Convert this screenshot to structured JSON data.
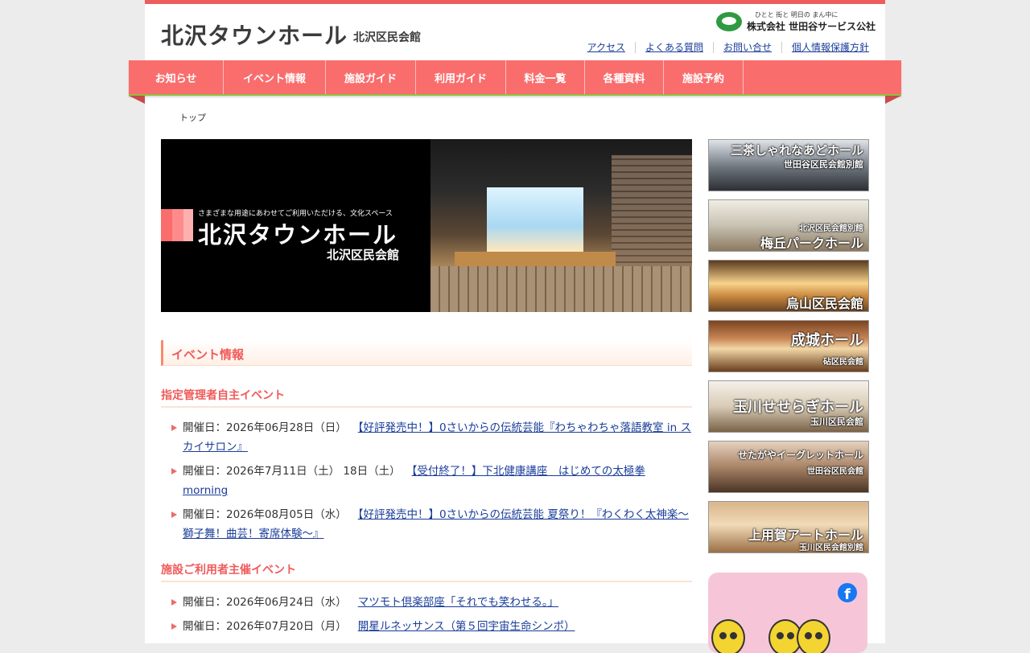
{
  "header": {
    "site_title": "北沢タウンホール",
    "site_subtitle": "北沢区民会館",
    "corp_tagline": "ひとと 街と 明日の まん中に",
    "corp_name": "株式会社 世田谷サービス公社",
    "top_links": [
      "アクセス",
      "よくある質問",
      "お問い合せ",
      "個人情報保護方針"
    ]
  },
  "nav": [
    "お知らせ",
    "イベント情報",
    "施設ガイド",
    "利用ガイド",
    "料金一覧",
    "各種資料",
    "施設予約"
  ],
  "breadcrumb": "トップ",
  "hero": {
    "tagline": "さまざまな用途にあわせてご利用いただける、文化スペース",
    "title": "北沢タウンホール",
    "subtitle": "北沢区民会館"
  },
  "events": {
    "heading": "イベント情報",
    "managed_heading": "指定管理者自主イベント",
    "managed": [
      {
        "date": "開催日：2026年06月28日（日）",
        "title": "【好評発売中！】0さいからの伝統芸能『わちゃわちゃ落語教室 in スカイサロン』"
      },
      {
        "date": "開催日：2026年7月11日（土） 18日（土）",
        "title": "【受付終了！】下北健康講座　はじめての太極拳 morning"
      },
      {
        "date": "開催日：2026年08月05日（水）",
        "title": "【好評発売中！】0さいからの伝統芸能 夏祭り！『わくわく太神楽～獅子舞！曲芸！寄席体験～』"
      }
    ],
    "user_heading": "施設ご利用者主催イベント",
    "user": [
      {
        "date": "開催日：2026年06月24日（水）",
        "title": "マツモト倶楽部座「それでも笑わせる。」"
      },
      {
        "date": "開催日：2026年07月20日（月）",
        "title": "開星ルネッサンス（第５回宇宙生命シンポ）"
      }
    ]
  },
  "banners": [
    {
      "main": "三茶しゃれなあどホール",
      "sub": "世田谷区民会館別館"
    },
    {
      "main": "梅丘パークホール",
      "sub": "北沢区民会館別館"
    },
    {
      "main": "烏山区民会館",
      "sub": ""
    },
    {
      "main": "成城ホール",
      "sub": "砧区民会館"
    },
    {
      "main": "玉川せせらぎホール",
      "sub": "玉川区民会館"
    },
    {
      "main": "せたがやイーグレットホール",
      "sub": "世田谷区民会館"
    },
    {
      "main": "上用賀アートホール",
      "sub": "玉川区民会館別館"
    }
  ],
  "social": {
    "icon": "facebook-icon"
  },
  "colors": {
    "accent": "#fa6d6d",
    "link": "#1a3d99",
    "heading": "#f05a5a"
  }
}
